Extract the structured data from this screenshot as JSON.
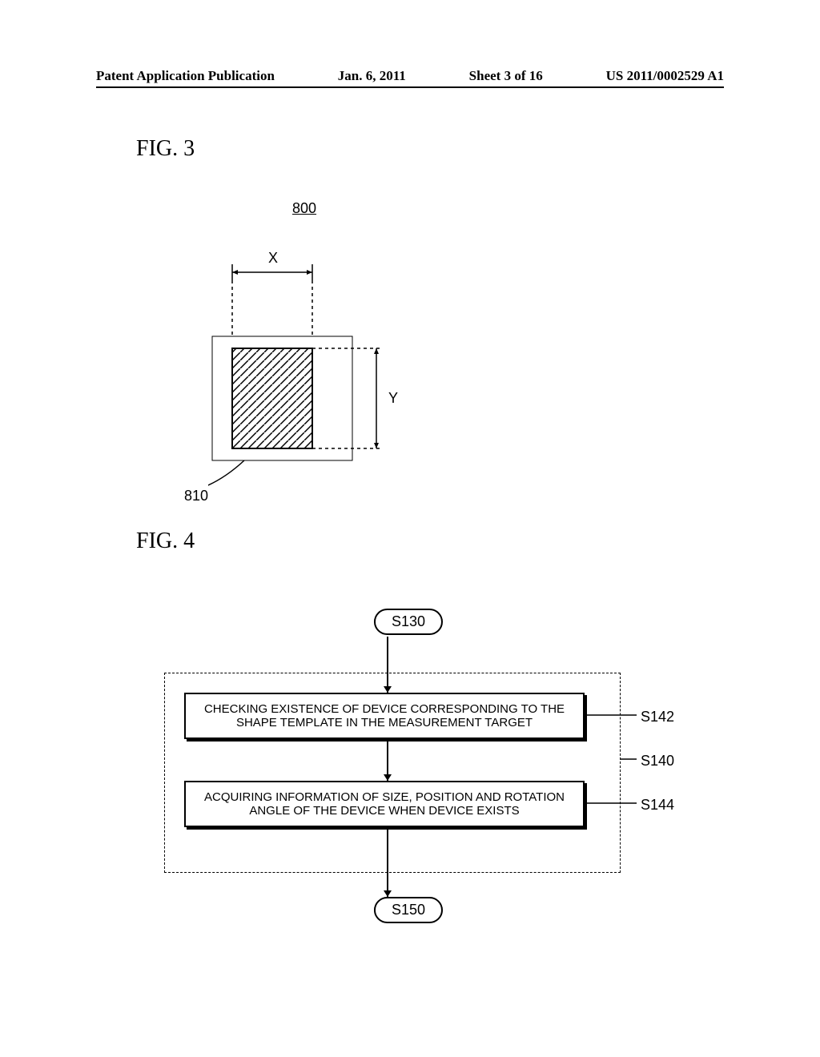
{
  "header": {
    "left": "Patent Application Publication",
    "center": "Jan. 6, 2011",
    "sheet": "Sheet 3 of 16",
    "right": "US 2011/0002529 A1"
  },
  "fig3": {
    "label": "FIG. 3",
    "ref800": "800",
    "ref810": "810",
    "x_label": "X",
    "y_label": "Y"
  },
  "fig4": {
    "label": "FIG. 4",
    "s130": "S130",
    "s150": "S150",
    "step1": "CHECKING EXISTENCE OF DEVICE CORRESPONDING TO THE SHAPE TEMPLATE IN THE MEASUREMENT TARGET",
    "step2": "ACQUIRING INFORMATION OF SIZE, POSITION AND ROTATION ANGLE OF THE DEVICE WHEN DEVICE EXISTS",
    "s142": "S142",
    "s140": "S140",
    "s144": "S144"
  }
}
